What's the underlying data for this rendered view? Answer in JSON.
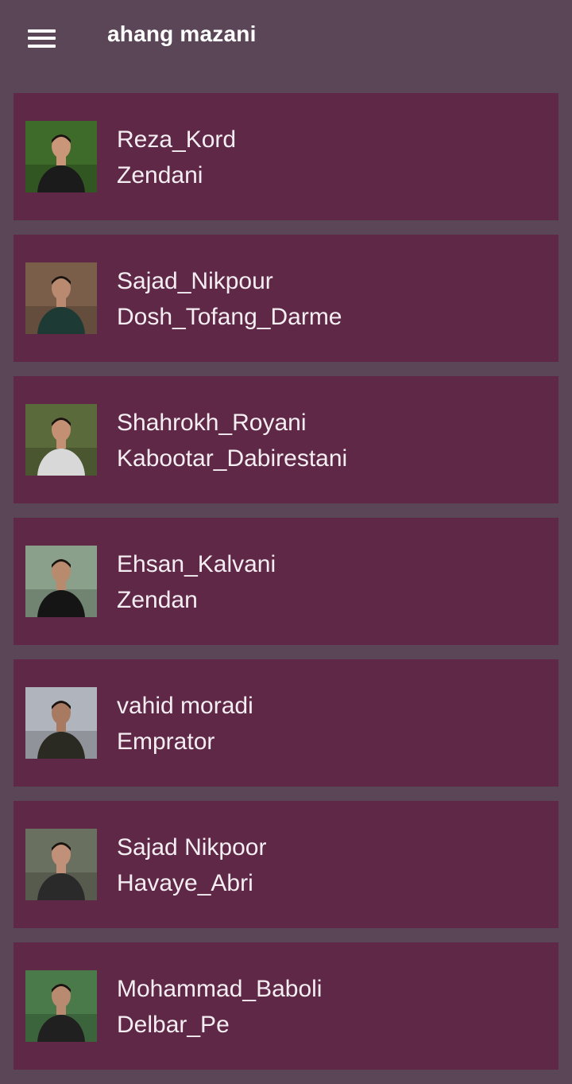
{
  "appbar": {
    "title": "ahang mazani",
    "menu_icon": "hamburger-menu-icon"
  },
  "colors": {
    "background": "#5b4658",
    "card": "#5e2846",
    "text": "#f4eef2"
  },
  "songs": [
    {
      "artist": "Reza_Kord",
      "song": "Zendani",
      "thumb_bg": "#3e6a2a",
      "thumb_fg": "#1b1b1b",
      "skin": "#c9967a"
    },
    {
      "artist": "Sajad_Nikpour",
      "song": "Dosh_Tofang_Darme",
      "thumb_bg": "#7a5e4a",
      "thumb_fg": "#1e3a34",
      "skin": "#b98a70"
    },
    {
      "artist": "Shahrokh_Royani",
      "song": "Kabootar_Dabirestani",
      "thumb_bg": "#5a6a3a",
      "thumb_fg": "#d8d8d8",
      "skin": "#c49074"
    },
    {
      "artist": "Ehsan_Kalvani",
      "song": "Zendan",
      "thumb_bg": "#8aa08a",
      "thumb_fg": "#151515",
      "skin": "#b88a6e"
    },
    {
      "artist": "vahid moradi",
      "song": "Emprator",
      "thumb_bg": "#b0b4bc",
      "thumb_fg": "#2a2a22",
      "skin": "#a87a62"
    },
    {
      "artist": "Sajad Nikpoor",
      "song": "Havaye_Abri",
      "thumb_bg": "#6a7060",
      "thumb_fg": "#2a2a2a",
      "skin": "#c09078"
    },
    {
      "artist": "Mohammad_Baboli",
      "song": "Delbar_Pe",
      "thumb_bg": "#4a7a4a",
      "thumb_fg": "#202020",
      "skin": "#b88a70"
    }
  ]
}
